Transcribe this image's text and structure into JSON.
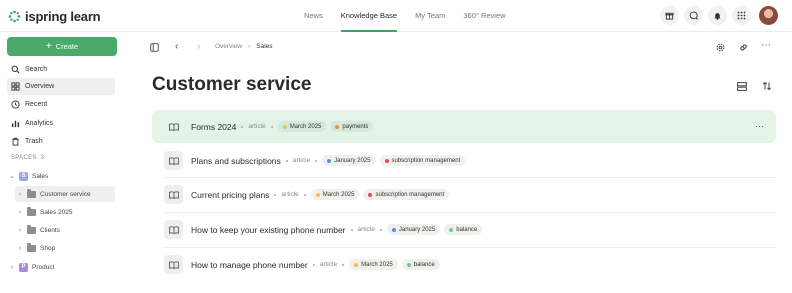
{
  "app": {
    "brand": "ispring learn",
    "nav": [
      {
        "label": "News",
        "active": false
      },
      {
        "label": "Knowledge Base",
        "active": true
      },
      {
        "label": "My Team",
        "active": false
      },
      {
        "label": "360° Review",
        "active": false
      }
    ],
    "top_icons": [
      "gift-icon",
      "chat-icon",
      "bell-icon",
      "apps-grid-icon",
      "user-avatar"
    ]
  },
  "sidebar": {
    "create_label": "Create",
    "items": [
      {
        "label": "Search",
        "icon": "search-icon",
        "active": false
      },
      {
        "label": "Overview",
        "icon": "overview-icon",
        "active": true
      },
      {
        "label": "Recent",
        "icon": "clock-icon",
        "active": false
      },
      {
        "label": "Analytics",
        "icon": "analytics-icon",
        "active": false
      },
      {
        "label": "Trash",
        "icon": "trash-icon",
        "active": false
      }
    ],
    "spaces_label": "SPACES",
    "spaces_count": "3",
    "spaces": [
      {
        "letter": "S",
        "label": "Sales",
        "color": "#9aa6e6"
      },
      {
        "letter": "P",
        "label": "Product",
        "color": "#a88cd9"
      }
    ],
    "folders": [
      {
        "label": "Customer service",
        "active": true
      },
      {
        "label": "Sales 2025",
        "active": false
      },
      {
        "label": "Clients",
        "active": false
      },
      {
        "label": "Shop",
        "active": false
      }
    ]
  },
  "breadcrumb": {
    "items": [
      "Overview",
      "Sales"
    ]
  },
  "page": {
    "title": "Customer service",
    "rows": [
      {
        "title": "Forms 2024",
        "type": "article",
        "tags": [
          {
            "label": "March 2025",
            "color": "#f1c04a"
          },
          {
            "label": "payments",
            "color": "#f08a3a"
          }
        ]
      },
      {
        "title": "Plans and subscriptions",
        "type": "article",
        "tags": [
          {
            "label": "January 2025",
            "color": "#5b8def"
          },
          {
            "label": "subscription management",
            "color": "#e8485f"
          }
        ]
      },
      {
        "title": "Current pricing plans",
        "type": "article",
        "tags": [
          {
            "label": "March 2025",
            "color": "#f1c04a"
          },
          {
            "label": "subscription management",
            "color": "#e8485f"
          }
        ]
      },
      {
        "title": "How to keep your existing phone number",
        "type": "article",
        "tags": [
          {
            "label": "January 2025",
            "color": "#5b8def"
          },
          {
            "label": "balance",
            "color": "#63c9a4"
          }
        ]
      },
      {
        "title": "How to manage phone number",
        "type": "article",
        "tags": [
          {
            "label": "March 2025",
            "color": "#f1c04a"
          },
          {
            "label": "balance",
            "color": "#63c9a4"
          }
        ]
      }
    ]
  },
  "colors": {
    "accent": "#3aa564",
    "highlight_row": "#e3f3e8"
  }
}
